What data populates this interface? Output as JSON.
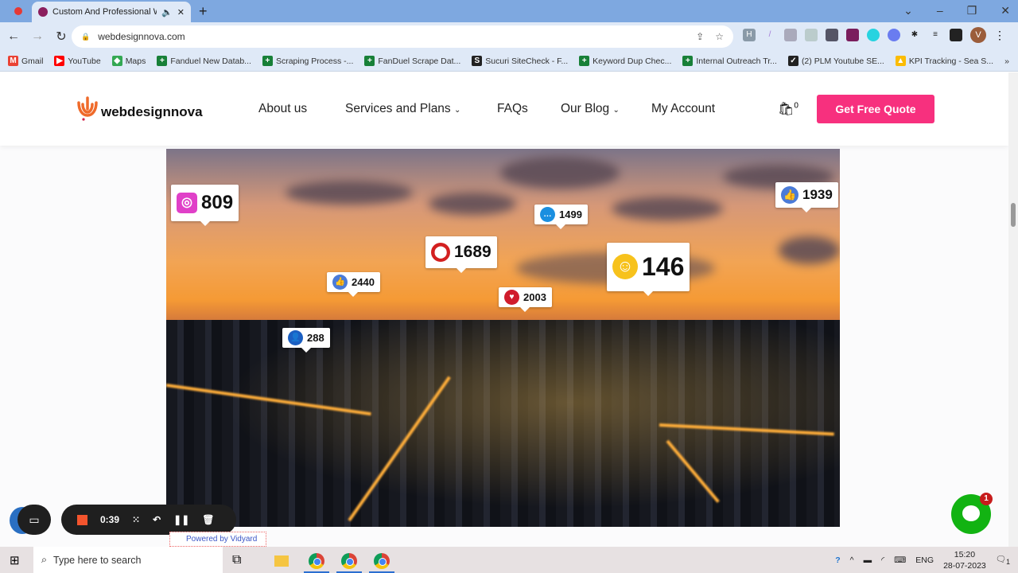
{
  "browser": {
    "tab_title": "Custom And Professional We",
    "url": "webdesignnova.com",
    "avatar_letter": "V",
    "bookmarks": [
      {
        "label": "Gmail",
        "color": "#ea4335",
        "icon": "M"
      },
      {
        "label": "YouTube",
        "color": "#ff0000",
        "icon": "▶"
      },
      {
        "label": "Maps",
        "color": "#34a853",
        "icon": "◆"
      },
      {
        "label": "Fanduel New Datab...",
        "color": "#188038",
        "icon": "+"
      },
      {
        "label": "Scraping Process -...",
        "color": "#188038",
        "icon": "+"
      },
      {
        "label": "FanDuel Scrape Dat...",
        "color": "#188038",
        "icon": "+"
      },
      {
        "label": "Sucuri SiteCheck - F...",
        "color": "#222222",
        "icon": "S"
      },
      {
        "label": "Keyword Dup Chec...",
        "color": "#188038",
        "icon": "+"
      },
      {
        "label": "Internal Outreach Tr...",
        "color": "#188038",
        "icon": "+"
      },
      {
        "label": "(2) PLM Youtube SE...",
        "color": "#222222",
        "icon": "✓"
      },
      {
        "label": "KPI Tracking - Sea S...",
        "color": "#fbbc04",
        "icon": "▲"
      }
    ],
    "more": "»"
  },
  "site": {
    "logo": "webdesignnova",
    "menu": [
      {
        "label": "About us",
        "dropdown": false
      },
      {
        "label": "Services and Plans",
        "dropdown": true
      },
      {
        "label": "FAQs",
        "dropdown": false
      },
      {
        "label": "Our Blog",
        "dropdown": true
      },
      {
        "label": "My Account",
        "dropdown": false
      }
    ],
    "cart_count": "0",
    "cta": "Get Free Quote",
    "accent": "#f7307e"
  },
  "hero": {
    "badges": [
      {
        "icon": "instagram-icon",
        "value": "809"
      },
      {
        "icon": "thumbs-up-icon",
        "value": "1939"
      },
      {
        "icon": "chat-icon",
        "value": "1499"
      },
      {
        "icon": "location-pin-icon",
        "value": "1689"
      },
      {
        "icon": "smiley-icon",
        "value": "146"
      },
      {
        "icon": "thumbs-up-icon",
        "value": "2440"
      },
      {
        "icon": "heart-icon",
        "value": "2003"
      },
      {
        "icon": "user-icon",
        "value": "288"
      }
    ]
  },
  "recorder": {
    "time": "0:39",
    "powered": "Powered by Vidyard"
  },
  "chat_badge": "1",
  "taskbar": {
    "search_placeholder": "Type here to search",
    "lang": "ENG",
    "time": "15:20",
    "date": "28-07-2023",
    "notif": "1"
  }
}
